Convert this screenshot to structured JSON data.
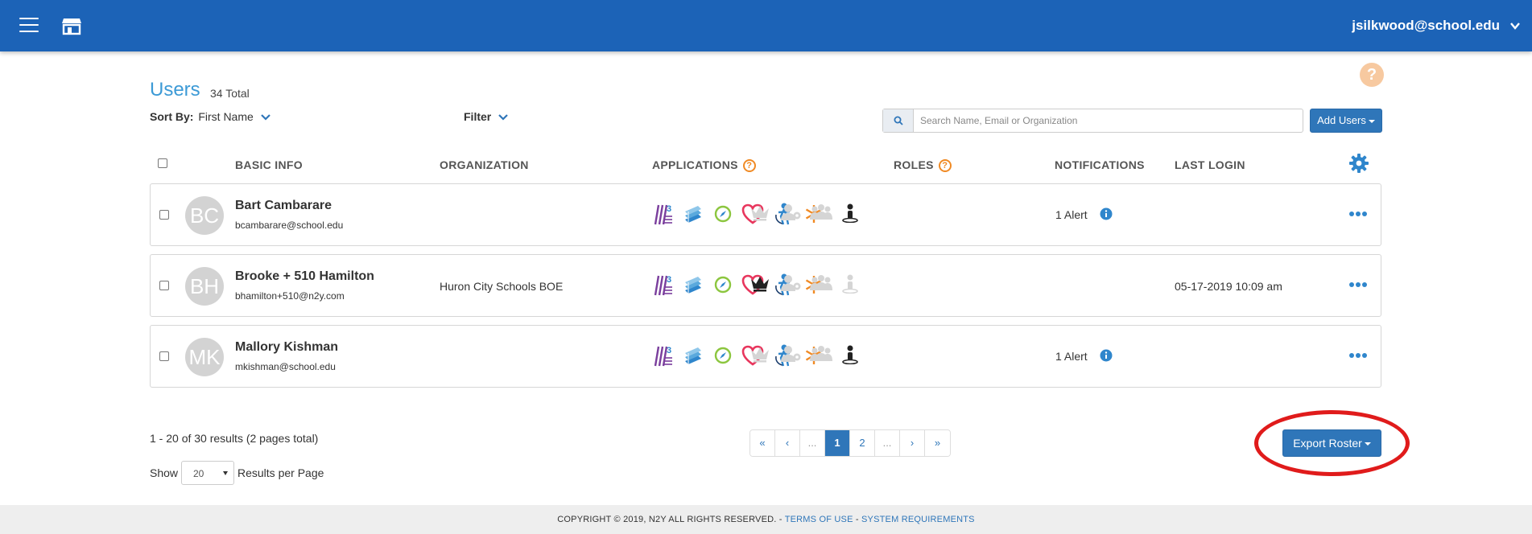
{
  "header": {
    "user_email": "jsilkwood@school.edu",
    "brand_color": "#1c63b7"
  },
  "page": {
    "title": "Users",
    "total": "34 Total",
    "sort_label": "Sort By:",
    "sort_value": "First Name",
    "filter_label": "Filter"
  },
  "search": {
    "placeholder": "Search Name, Email or Organization",
    "value": ""
  },
  "actions": {
    "add_users": "Add Users",
    "export_roster": "Export Roster"
  },
  "columns": {
    "basic_info": "BASIC INFO",
    "organization": "ORGANIZATION",
    "applications": "APPLICATIONS",
    "roles": "ROLES",
    "notifications": "NOTIFICATIONS",
    "last_login": "LAST LOGIN"
  },
  "users": [
    {
      "initials": "BC",
      "name": "Bart Cambarare",
      "email": "bcambarare@school.edu",
      "organization": "",
      "notification": "1 Alert",
      "last_login": "",
      "roles_active": [
        "role-teacher"
      ]
    },
    {
      "initials": "BH",
      "name": "Brooke + 510 Hamilton",
      "email": "bhamilton+510@n2y.com",
      "organization": "Huron City Schools BOE",
      "notification": "",
      "last_login": "05-17-2019 10:09 am",
      "roles_active": [
        "role-admin"
      ]
    },
    {
      "initials": "MK",
      "name": "Mallory Kishman",
      "email": "mkishman@school.edu",
      "organization": "",
      "notification": "1 Alert",
      "last_login": "",
      "roles_active": [
        "role-teacher"
      ]
    }
  ],
  "pagination": {
    "summary": "1 - 20 of 30 results (2 pages total)",
    "show_label": "Show",
    "per_page": "20",
    "per_page_label": "Results per Page",
    "first": "«",
    "prev": "‹",
    "ellipsis_left": "...",
    "page1": "1",
    "page2": "2",
    "ellipsis_right": "...",
    "next": "›",
    "last": "»"
  },
  "footer": {
    "copyright": "COPYRIGHT © 2019, N2Y ALL RIGHTS RESERVED. -",
    "terms": "TERMS OF USE",
    "separator": "-",
    "requirements": "SYSTEM REQUIREMENTS"
  },
  "help_icon": "?"
}
